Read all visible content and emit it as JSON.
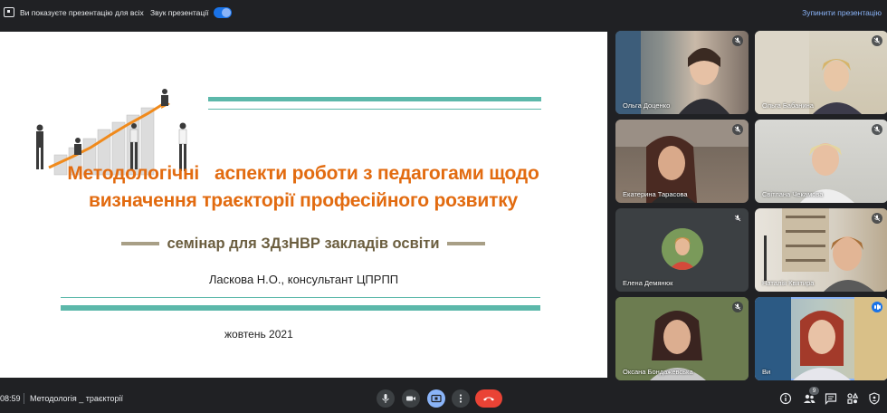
{
  "topbar": {
    "presenting_text": "Ви показуєте презентацію для всіх",
    "sound_label": "Звук презентації",
    "sound_toggle_on": true,
    "stop_label": "Зупинити презентацію"
  },
  "slide": {
    "title_line1": "Методологічні   аспекти роботи з педагогами щодо",
    "title_line2": "визначення траєкторії професійного розвитку",
    "subtitle": "семінар для ЗДзНВР закладів освіти",
    "author": "Ласкова Н.О., консультант ЦПРПП",
    "date": "жовтень 2021",
    "colors": {
      "title": "#e26b10",
      "accent_line": "#5cb8aa",
      "subtitle": "#6b5e3f"
    }
  },
  "participants": [
    {
      "name": "Ольга Доценко",
      "muted": true
    },
    {
      "name": "Ольга Бабанина",
      "muted": true
    },
    {
      "name": "Екатерина Тарасова",
      "muted": true
    },
    {
      "name": "Світлана Чекамова",
      "muted": true
    },
    {
      "name": "Елена Демянюк",
      "muted": true
    },
    {
      "name": "Наталія Квятира",
      "muted": true
    },
    {
      "name": "Оксана Бондажевська",
      "muted": true
    },
    {
      "name": "Ви",
      "muted": false,
      "speaking": true
    }
  ],
  "bottombar": {
    "time": "08:59",
    "meeting_name": "Методологія _ траєкторії",
    "participants_count": "9",
    "controls": [
      "mic-icon",
      "camera-icon",
      "present-screen-icon",
      "more-options-icon",
      "end-call-icon"
    ],
    "right_controls": [
      "info-icon",
      "people-icon",
      "chat-icon",
      "activities-icon",
      "host-controls-icon"
    ]
  }
}
